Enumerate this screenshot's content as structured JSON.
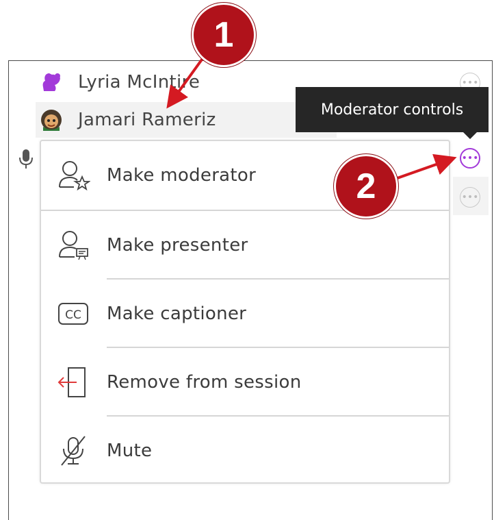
{
  "participants": [
    {
      "name": "Lyria McIntire"
    },
    {
      "name": "Jamari Rameriz"
    }
  ],
  "tooltip": {
    "text": "Moderator controls"
  },
  "menu": {
    "items": [
      {
        "label": "Make moderator",
        "icon": "make-moderator-icon"
      },
      {
        "label": "Make presenter",
        "icon": "make-presenter-icon"
      },
      {
        "label": "Make captioner",
        "icon": "closed-captions-icon"
      },
      {
        "label": "Remove from session",
        "icon": "remove-from-session-icon"
      },
      {
        "label": "Mute",
        "icon": "muted-microphone-icon"
      }
    ]
  },
  "callouts": {
    "one": "1",
    "two": "2"
  },
  "colors": {
    "callout": "#b0121b",
    "active_accent": "#a23ad9",
    "tooltip_bg": "#262626",
    "remove_icon": "#e03a3a"
  }
}
